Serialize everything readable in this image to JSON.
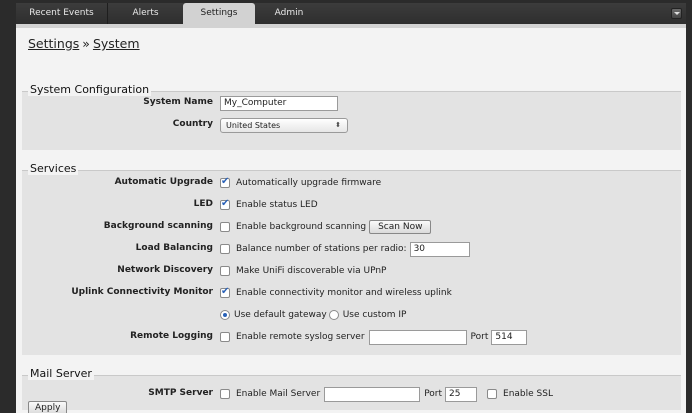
{
  "tabs": [
    {
      "label": "Recent Events"
    },
    {
      "label": "Alerts"
    },
    {
      "label": "Settings"
    },
    {
      "label": "Admin"
    }
  ],
  "breadcrumb": {
    "parent": "Settings",
    "separator": "»",
    "current": "System"
  },
  "system": {
    "legend": "System Configuration",
    "name_label": "System Name",
    "name_value": "My_Computer",
    "country_label": "Country",
    "country_value": "United States",
    "select_arrows": "⬍"
  },
  "services": {
    "legend": "Services",
    "auto_upgrade": {
      "label": "Automatic Upgrade",
      "text": "Automatically upgrade firmware",
      "checked": true
    },
    "led": {
      "label": "LED",
      "text": "Enable status LED",
      "checked": true
    },
    "bg_scan": {
      "label": "Background scanning",
      "text": "Enable background scanning",
      "checked": false,
      "button": "Scan Now"
    },
    "load_bal": {
      "label": "Load Balancing",
      "text": "Balance number of stations per radio:",
      "checked": false,
      "value": "30"
    },
    "net_disc": {
      "label": "Network Discovery",
      "text": "Make UniFi discoverable via UPnP",
      "checked": false
    },
    "uplink": {
      "label": "Uplink Connectivity Monitor",
      "text": "Enable connectivity monitor and wireless uplink",
      "checked": true
    },
    "gateway": {
      "default_text": "Use default gateway",
      "custom_text": "Use custom IP",
      "selected": "default"
    },
    "remote_log": {
      "label": "Remote Logging",
      "text": "Enable remote syslog server",
      "checked": false,
      "server": "",
      "port_label": "Port",
      "port": "514"
    }
  },
  "mail": {
    "legend": "Mail Server",
    "smtp_label": "SMTP Server",
    "enable_text": "Enable Mail Server",
    "server": "",
    "port_label": "Port",
    "port": "25",
    "ssl_text": "Enable SSL"
  },
  "apply_label": "Apply"
}
